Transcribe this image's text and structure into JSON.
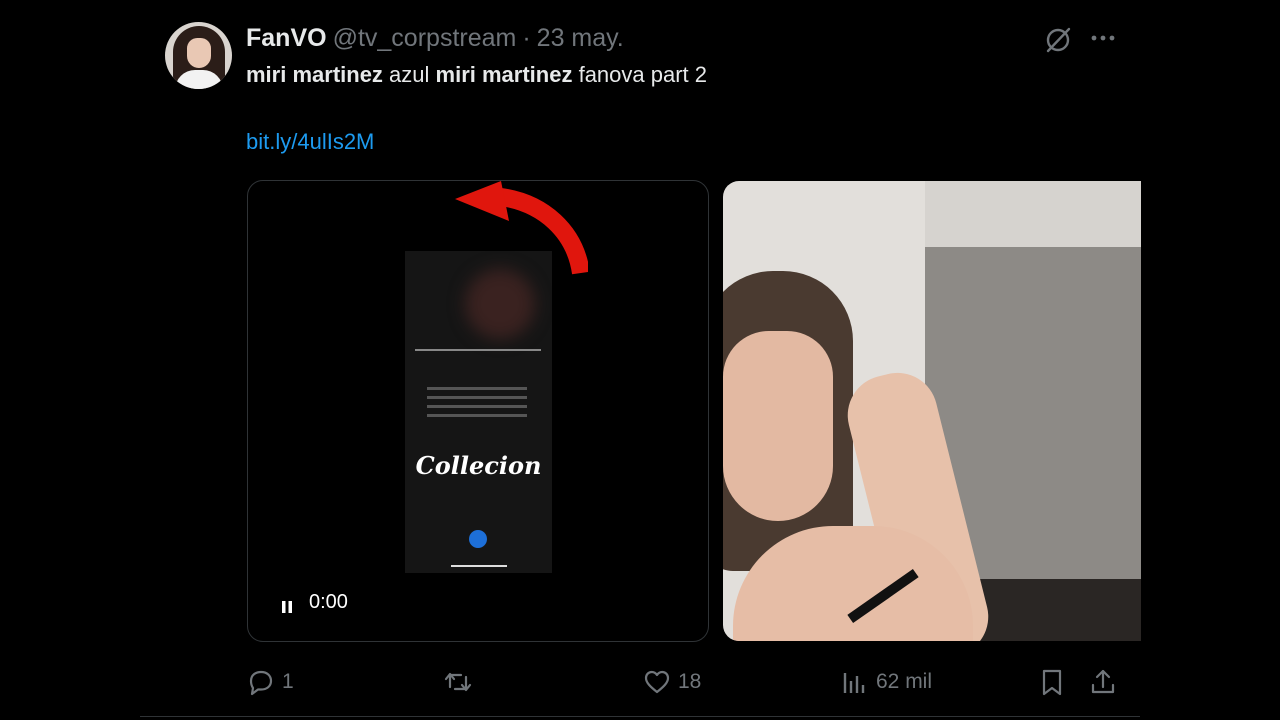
{
  "author": {
    "name": "FanVO",
    "handle": "@tv_corpstream",
    "separator": "·",
    "time": "23 may."
  },
  "tweet": {
    "bold_1": "miri martinez",
    "plain_1": " azul ",
    "bold_2": "miri martinez",
    "plain_2": " fanova part 2",
    "link": "bit.ly/4ulIs2M"
  },
  "video": {
    "overlay_text": "Collecion",
    "time": "0:00"
  },
  "actions": {
    "replies": "1",
    "retweets": "",
    "likes": "18",
    "views": "62 mil"
  },
  "colors": {
    "background": "#000000",
    "link": "#1d9bf0",
    "muted": "#71767b",
    "arrow": "#e0160d"
  },
  "icons": {
    "grok": "grok-icon",
    "more": "more-icon",
    "reply": "reply-icon",
    "retweet": "retweet-icon",
    "like": "heart-icon",
    "views": "views-icon",
    "bookmark": "bookmark-icon",
    "share": "share-icon",
    "pause": "pause-icon"
  }
}
